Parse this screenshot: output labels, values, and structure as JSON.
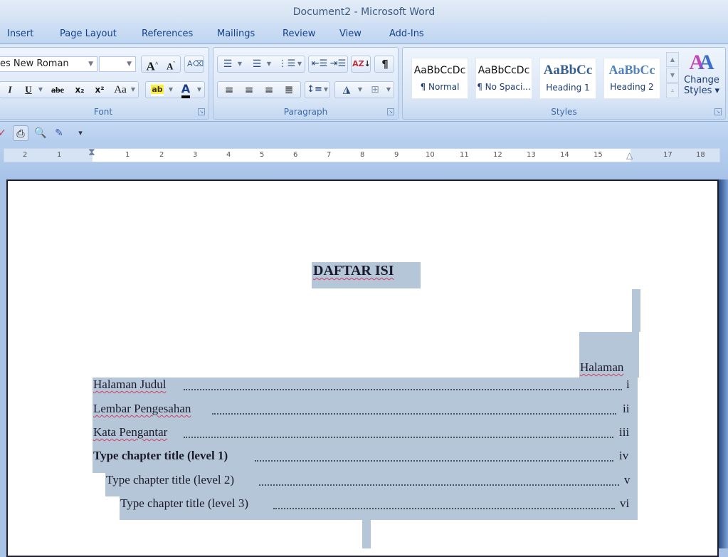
{
  "window": {
    "title": "Document2 - Microsoft Word"
  },
  "tabs": [
    {
      "label": "Insert"
    },
    {
      "label": "Page Layout"
    },
    {
      "label": "References"
    },
    {
      "label": "Mailings"
    },
    {
      "label": "Review"
    },
    {
      "label": "View"
    },
    {
      "label": "Add-Ins"
    }
  ],
  "ribbon": {
    "font": {
      "label": "Font",
      "font_name": "es New Roman",
      "font_size": "",
      "grow_font": "A",
      "shrink_font": "A",
      "italic": "I",
      "underline": "U",
      "strikethrough": "abe",
      "subscript": "x₂",
      "superscript": "x²",
      "change_case": "Aa",
      "highlight": "ab",
      "font_color": "A"
    },
    "paragraph": {
      "label": "Paragraph",
      "show_marks": "¶"
    },
    "styles": {
      "label": "Styles",
      "items": [
        {
          "sample": "AaBbCcDc",
          "name": "¶ Normal"
        },
        {
          "sample": "AaBbCcDc",
          "name": "¶ No Spaci..."
        },
        {
          "sample": "AaBbCc",
          "name": "Heading 1"
        },
        {
          "sample": "AaBbCc",
          "name": "Heading 2"
        }
      ],
      "change_styles_line1": "Change",
      "change_styles_line2": "Styles ▾"
    }
  },
  "ruler": {
    "ticks": [
      "2",
      "1",
      "1",
      "2",
      "3",
      "4",
      "5",
      "6",
      "7",
      "8",
      "9",
      "10",
      "11",
      "12",
      "13",
      "14",
      "15",
      "17",
      "18"
    ]
  },
  "document": {
    "title": "DAFTAR ISI",
    "page_header": "Halaman",
    "toc": [
      {
        "text": "Halaman Judul",
        "page": "i",
        "level": 0,
        "bold": false
      },
      {
        "text": "Lembar Pengesahan",
        "page": "ii",
        "level": 0,
        "bold": false
      },
      {
        "text": "Kata Pengantar",
        "page": "iii",
        "level": 0,
        "bold": false
      },
      {
        "text": "Type chapter title (level 1)",
        "page": "iv",
        "level": 1,
        "bold": true
      },
      {
        "text": "Type chapter title (level 2)",
        "page": "v",
        "level": 2,
        "bold": false
      },
      {
        "text": "Type chapter title (level 3)",
        "page": "vi",
        "level": 3,
        "bold": false
      }
    ]
  },
  "colors": {
    "selection": "#b6c6d9",
    "ribbon_text": "#15428b"
  }
}
